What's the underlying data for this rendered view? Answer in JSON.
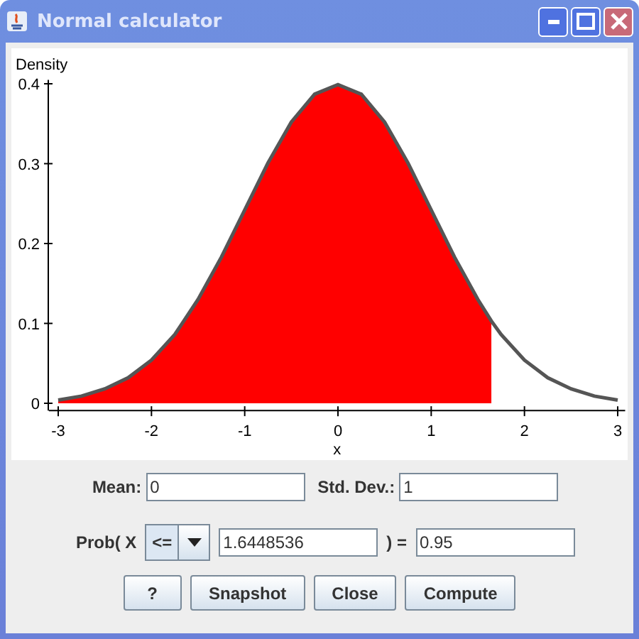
{
  "window": {
    "title": "Normal calculator"
  },
  "plot": {
    "chart_data": {
      "type": "area",
      "ylabel": "Density",
      "xlabel": "x",
      "x": [
        -3,
        -2.75,
        -2.5,
        -2.25,
        -2,
        -1.75,
        -1.5,
        -1.25,
        -1,
        -0.75,
        -0.5,
        -0.25,
        0,
        0.25,
        0.5,
        0.75,
        1,
        1.25,
        1.5,
        1.645,
        1.75,
        2,
        2.25,
        2.5,
        2.75,
        3
      ],
      "series": [
        {
          "type": "area",
          "color": "#ff0000",
          "values": [
            0.004,
            0.009,
            0.018,
            0.032,
            0.054,
            0.086,
            0.13,
            0.183,
            0.242,
            0.301,
            0.352,
            0.387,
            0.399,
            0.387,
            0.352,
            0.301,
            0.242,
            0.183,
            0.13,
            0.103,
            null,
            null,
            null,
            null,
            null,
            null
          ]
        },
        {
          "type": "line",
          "color": "#555555",
          "values": [
            0.004,
            0.009,
            0.018,
            0.032,
            0.054,
            0.086,
            0.13,
            0.183,
            0.242,
            0.301,
            0.352,
            0.387,
            0.399,
            0.387,
            0.352,
            0.301,
            0.242,
            0.183,
            0.13,
            0.103,
            0.086,
            0.054,
            0.032,
            0.018,
            0.009,
            0.004
          ]
        }
      ],
      "xlim": [
        -3.1,
        3.08
      ],
      "ylim": [
        -0.009,
        0.405
      ],
      "xticks": [
        -3,
        -2,
        -1,
        0,
        1,
        2,
        3
      ],
      "yticks": [
        0,
        0.1,
        0.2,
        0.3,
        0.4
      ]
    }
  },
  "mean": {
    "label": "Mean:",
    "value": "0"
  },
  "std_dev": {
    "label": "Std. Dev.:",
    "value": "1"
  },
  "probability": {
    "label": "Prob( X",
    "operator": "<=",
    "x_value": "1.6448536",
    "equals": ") =",
    "result": "0.95"
  },
  "buttons": [
    "?",
    "Snapshot",
    "Close",
    "Compute"
  ]
}
